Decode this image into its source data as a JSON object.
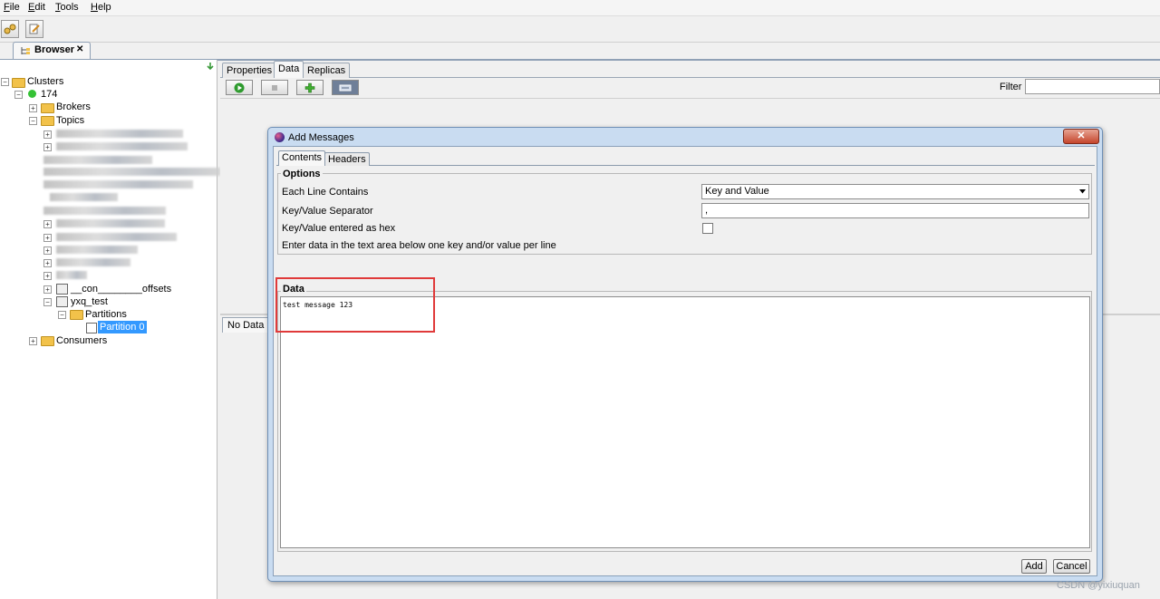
{
  "menu": {
    "file": "File",
    "edit": "Edit",
    "tools": "Tools",
    "help": "Help"
  },
  "browser_tab": {
    "label": "Browser",
    "close": "✕"
  },
  "tree": {
    "clusters": "Clusters",
    "cluster_name": "174",
    "brokers": "Brokers",
    "topics": "Topics",
    "consumer_offsets": "__con________offsets",
    "topic_selected": "yxq_test",
    "partitions": "Partitions",
    "partition": "Partition 0",
    "consumers": "Consumers"
  },
  "right_tabs": [
    "Properties",
    "Data",
    "Replicas"
  ],
  "filter": {
    "label": "Filter",
    "value": ""
  },
  "bottom_tab": "No Data",
  "dialog": {
    "title": "Add Messages",
    "close": "✕",
    "tabs": [
      "Contents",
      "Headers"
    ],
    "options_legend": "Options",
    "each_line_label": "Each Line Contains",
    "each_line_value": "Key and Value",
    "separator_label": "Key/Value Separator",
    "separator_value": ",",
    "hex_label": "Key/Value entered as hex",
    "hex_checked": false,
    "hint": "Enter data in the text area below one key and/or value per line",
    "data_legend": "Data",
    "data_text": "test message 123",
    "add_button": "Add",
    "cancel_button": "Cancel"
  },
  "watermark": "CSDN @yixiuquan",
  "colors": {
    "highlight": "#e03a3a",
    "selection": "#3399ff",
    "title_bar": "#c9dcf1"
  }
}
